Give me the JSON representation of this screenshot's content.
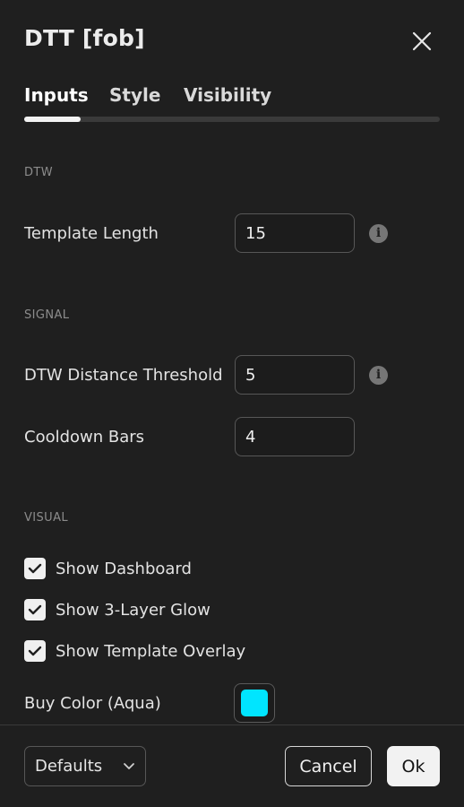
{
  "dialog": {
    "title": "DTT [fob]"
  },
  "tabs": [
    {
      "label": "Inputs",
      "active": true
    },
    {
      "label": "Style",
      "active": false
    },
    {
      "label": "Visibility",
      "active": false
    }
  ],
  "sections": {
    "dtw": {
      "title": "DTW",
      "template_length": {
        "label": "Template Length",
        "value": "15"
      }
    },
    "signal": {
      "title": "SIGNAL",
      "dtw_distance_threshold": {
        "label": "DTW Distance Threshold",
        "value": "5"
      },
      "cooldown_bars": {
        "label": "Cooldown Bars",
        "value": "4"
      }
    },
    "visual": {
      "title": "VISUAL",
      "checkboxes": [
        {
          "label": "Show Dashboard",
          "checked": true
        },
        {
          "label": "Show 3-Layer Glow",
          "checked": true
        },
        {
          "label": "Show Template Overlay",
          "checked": true
        }
      ],
      "buy_color": {
        "label": "Buy Color (Aqua)",
        "color": "#00e5ff"
      }
    }
  },
  "footer": {
    "defaults_label": "Defaults",
    "cancel_label": "Cancel",
    "ok_label": "Ok"
  },
  "icons": {
    "close": "close-icon",
    "info": "info-icon",
    "check": "checkmark-icon",
    "chevron": "chevron-down-icon"
  },
  "colors": {
    "background": "#1f1f1f",
    "accent_active_tab": "#f2f2f2",
    "buy_color": "#00e5ff"
  }
}
